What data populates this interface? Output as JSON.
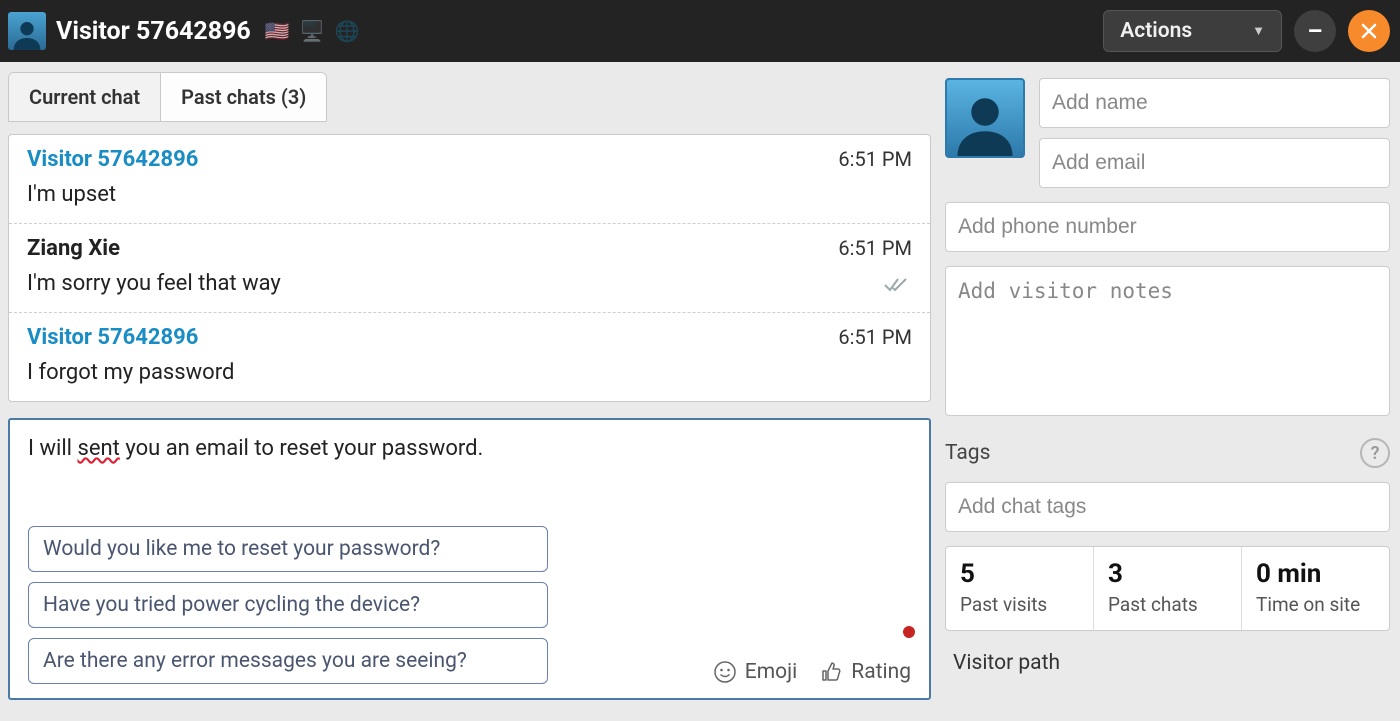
{
  "header": {
    "title": "Visitor 57642896",
    "actions_label": "Actions"
  },
  "tabs": {
    "current": "Current chat",
    "past": "Past chats (3)"
  },
  "chat": {
    "messages": [
      {
        "author": "Visitor 57642896",
        "role": "visitor",
        "time": "6:51 PM",
        "body": "I'm upset"
      },
      {
        "author": "Ziang Xie",
        "role": "agent",
        "time": "6:51 PM",
        "body": "I'm sorry you feel that way",
        "read": true
      },
      {
        "author": "Visitor 57642896",
        "role": "visitor",
        "time": "6:51 PM",
        "body": "I forgot my password"
      }
    ]
  },
  "composer": {
    "prefix": "I will ",
    "error_word": "sent",
    "suffix": " you an email to reset your password.",
    "suggestions": [
      "Would you like me to reset your password?",
      "Have you tried power cycling the device?",
      "Are there any error messages you are seeing?"
    ],
    "emoji_label": "Emoji",
    "rating_label": "Rating"
  },
  "profile": {
    "name_placeholder": "Add name",
    "email_placeholder": "Add email",
    "phone_placeholder": "Add phone number",
    "notes_placeholder": "Add visitor notes"
  },
  "tags": {
    "label": "Tags",
    "input_placeholder": "Add chat tags"
  },
  "stats": {
    "past_visits": {
      "value": "5",
      "label": "Past visits"
    },
    "past_chats": {
      "value": "3",
      "label": "Past chats"
    },
    "time_on_site": {
      "value": "0 min",
      "label": "Time on site"
    }
  },
  "visitor_path_label": "Visitor path"
}
